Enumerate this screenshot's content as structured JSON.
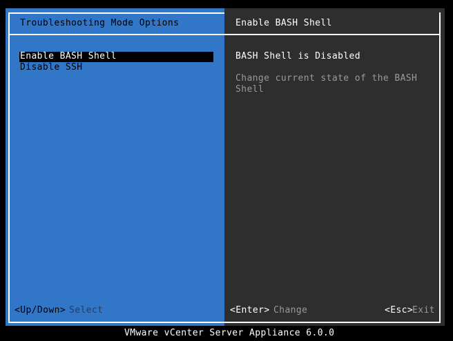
{
  "left": {
    "title": "Troubleshooting Mode Options",
    "items": [
      {
        "label": "Enable BASH Shell",
        "selected": true
      },
      {
        "label": "Disable SSH",
        "selected": false
      }
    ],
    "footer_key": "<Up/Down>",
    "footer_action": "Select"
  },
  "right": {
    "title": "Enable BASH Shell",
    "status": "BASH Shell is Disabled",
    "description_line1": "Change current state of the BASH",
    "description_line2": "Shell",
    "enter_key": "<Enter>",
    "enter_action": "Change",
    "esc_key": "<Esc>",
    "esc_action": "Exit"
  },
  "footer": {
    "product": "VMware vCenter Server Appliance 6.0.0"
  },
  "colors": {
    "left_bg": "#3276c8",
    "right_bg": "#2e2e2e",
    "screen_bg": "#000000"
  }
}
